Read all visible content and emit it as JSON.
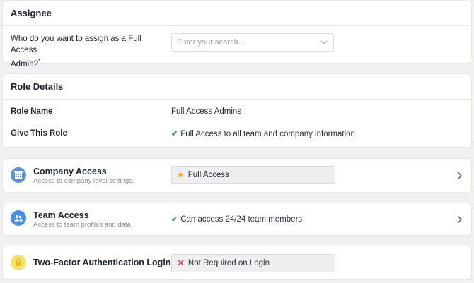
{
  "assignee": {
    "title": "Assignee",
    "question_line1": "Who do you want to assign as a Full Access",
    "question_line2": "Admin?",
    "required_mark": "*",
    "search_placeholder": "Enter your search..."
  },
  "role_details": {
    "title": "Role Details",
    "role_name_label": "Role Name",
    "role_name_value": "Full Access Admins",
    "give_role_label": "Give This Role",
    "give_role_value": "Full Access to all team and company information"
  },
  "company_access": {
    "title": "Company Access",
    "subtitle": "Access to company level settings.",
    "value": "Full Access",
    "icon": "building-icon"
  },
  "team_access": {
    "title": "Team Access",
    "subtitle": "Access to team profiles and data.",
    "value": "Can access 24/24 team members",
    "icon": "people-icon"
  },
  "two_factor": {
    "title": "Two-Factor Authentication Login",
    "value": "Not Required on Login",
    "icon": "lock-icon"
  },
  "colors": {
    "check": "#2ea44f",
    "star": "#f0a33a",
    "x_mark": "#d9534f",
    "company_icon_bg": "#5b8fd8",
    "team_icon_bg": "#4a90e2",
    "lock_icon_bg": "#f6e36b"
  }
}
